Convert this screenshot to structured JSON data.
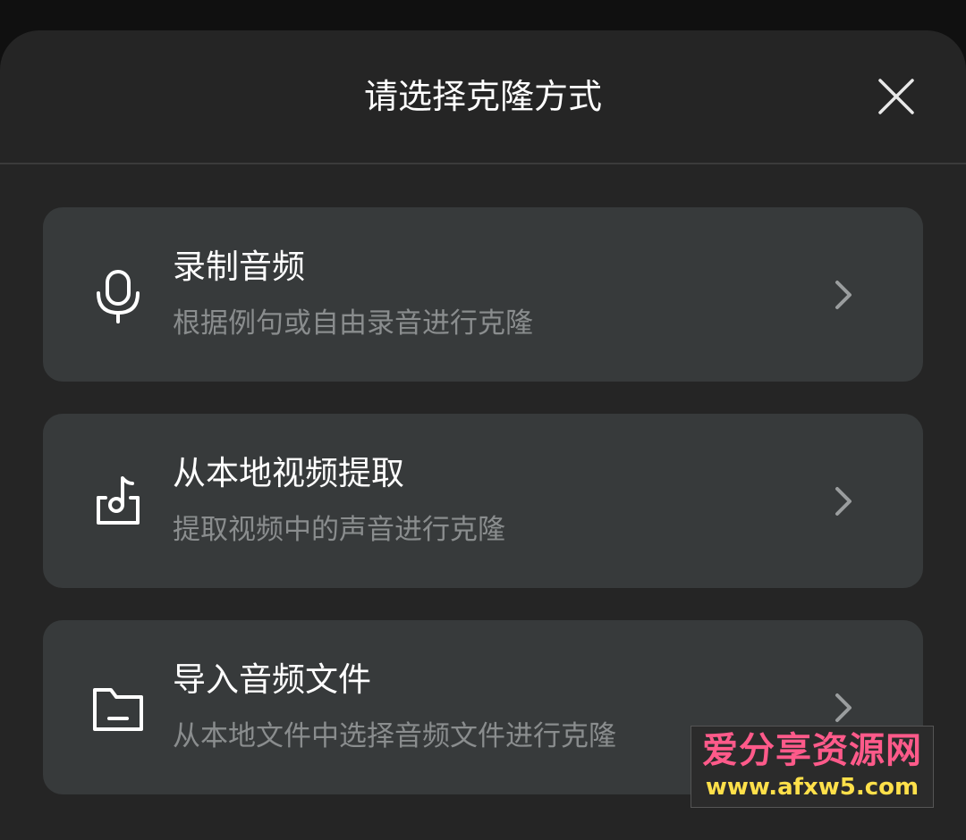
{
  "dialog": {
    "title": "请选择克隆方式"
  },
  "options": [
    {
      "icon": "microphone-icon",
      "title": "录制音频",
      "subtitle": "根据例句或自由录音进行克隆"
    },
    {
      "icon": "video-music-icon",
      "title": "从本地视频提取",
      "subtitle": "提取视频中的声音进行克隆"
    },
    {
      "icon": "folder-icon",
      "title": "导入音频文件",
      "subtitle": "从本地文件中选择音频文件进行克隆"
    }
  ],
  "watermark": {
    "title": "爱分享资源网",
    "url": "www.afxw5.com"
  }
}
